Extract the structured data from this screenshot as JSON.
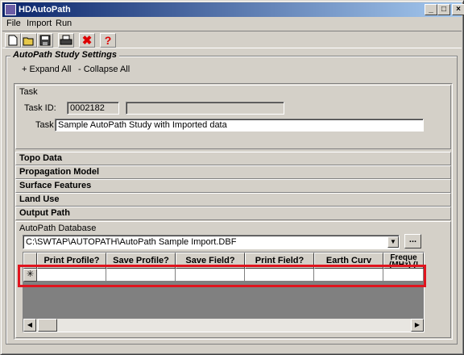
{
  "window": {
    "title": "HDAutoPath",
    "minimize": "_",
    "maximize": "□",
    "close": "×"
  },
  "menu": {
    "file": "File",
    "import": "Import",
    "run": "Run"
  },
  "toolbar_icons": [
    "new-file-icon",
    "open-folder-icon",
    "save-icon",
    "print-icon",
    "delete-icon",
    "help-icon"
  ],
  "toolbar_glyphs": {
    "delete": "✖",
    "help": "?"
  },
  "group": {
    "title": "AutoPath Study Settings"
  },
  "actions": {
    "expand_all": "+ Expand All",
    "collapse_all": "- Collapse All"
  },
  "task": {
    "header": "Task",
    "task_id_label": "Task ID:",
    "task_id_value": "0002182",
    "task_id_extra": "",
    "task_label": "Task",
    "task_value": "Sample AutoPath Study with Imported data"
  },
  "sections": {
    "topo": "Topo Data",
    "propagation": "Propagation Model",
    "surface": "Surface Features",
    "land_use": "Land Use",
    "output_path": "Output Path"
  },
  "database": {
    "label": "AutoPath Database",
    "path": "C:\\SWTAP\\AUTOPATH\\AutoPath Sample Import.DBF",
    "browse_label": "..."
  },
  "grid": {
    "columns": [
      "Print Profile?",
      "Save Profile?",
      "Save Field?",
      "Print Field?",
      "Earth Curv",
      "Freque (MHz) (I"
    ],
    "new_row_marker": "✳"
  },
  "colors": {
    "highlight": "#e0141e",
    "titlebar_start": "#0a246a",
    "face": "#d4d0c8"
  }
}
